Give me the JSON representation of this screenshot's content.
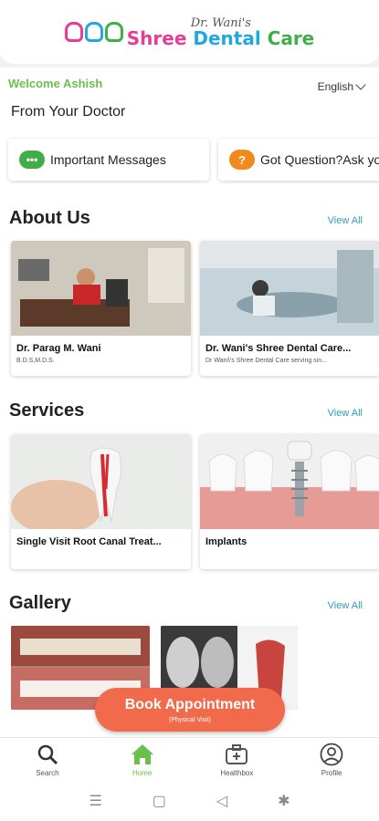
{
  "header": {
    "logo_sub": "Dr. Wani's",
    "logo_part1": "Shree ",
    "logo_part2": "Dental ",
    "logo_part3": "Care"
  },
  "greeting": "Welcome Ashish",
  "language": "English",
  "from_doctor": "From Your Doctor",
  "messages": [
    {
      "label": "Important Messages",
      "icon": "chat-icon",
      "badge": "•••"
    },
    {
      "label": "Got Question?Ask yo",
      "icon": "question-icon",
      "badge": "?"
    }
  ],
  "about": {
    "title": "About Us",
    "view_all": "View All",
    "cards": [
      {
        "title": "Dr. Parag M. Wani",
        "subtitle": "B.D.S,M.D.S."
      },
      {
        "title": "Dr. Wani's Shree Dental Care...",
        "subtitle": "Dr Wani\\'s Shree Dental Care serving sin..."
      }
    ]
  },
  "services": {
    "title": "Services",
    "view_all": "View All",
    "cards": [
      {
        "title": "Single Visit Root Canal Treat..."
      },
      {
        "title": "Implants"
      }
    ]
  },
  "gallery": {
    "title": "Gallery",
    "view_all": "View All"
  },
  "book": {
    "label": "Book Appointment",
    "sublabel": "(Physical Visit)"
  },
  "bottom_nav": [
    {
      "label": "Search",
      "icon": "search-icon"
    },
    {
      "label": "Home",
      "icon": "home-icon",
      "active": true
    },
    {
      "label": "Healthbox",
      "icon": "healthbox-icon"
    },
    {
      "label": "Profile",
      "icon": "profile-icon"
    }
  ],
  "colors": {
    "accent_green": "#6ac04b",
    "link_teal": "#2f9db8",
    "book_orange": "#f26a4c"
  }
}
